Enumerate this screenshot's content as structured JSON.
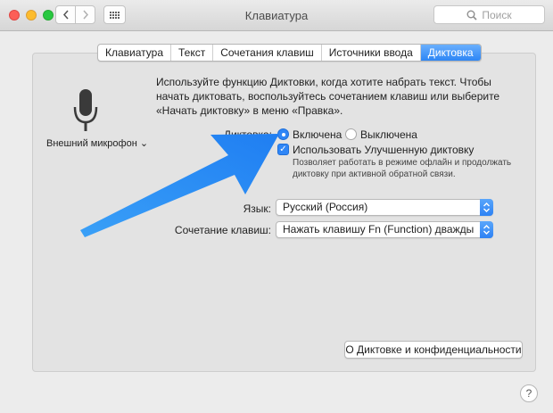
{
  "window": {
    "title": "Клавиатура"
  },
  "search": {
    "placeholder": "Поиск"
  },
  "tabs": [
    {
      "label": "Клавиатура",
      "active": false
    },
    {
      "label": "Текст",
      "active": false
    },
    {
      "label": "Сочетания клавиш",
      "active": false
    },
    {
      "label": "Источники ввода",
      "active": false
    },
    {
      "label": "Диктовка",
      "active": true
    }
  ],
  "mic": {
    "label": "Внешний микрофон ⌄",
    "icon": "microphone-icon"
  },
  "intro": {
    "text": "Используйте функцию Диктовки, когда хотите набрать текст. Чтобы начать диктовать, воспользуйтесь сочетанием клавиш или выберите «Начать диктовку» в меню «Правка»."
  },
  "dictation": {
    "label": "Диктовка:",
    "on_label": "Включена",
    "off_label": "Выключена",
    "selected": "on"
  },
  "enhanced": {
    "label": "Использовать Улучшенную диктовку",
    "checked": true,
    "note": "Позволяет работать в режиме офлайн и продолжать диктовку при активной обратной связи."
  },
  "language": {
    "label": "Язык:",
    "value": "Русский (Россия)"
  },
  "shortcut": {
    "label": "Сочетание клавиш:",
    "value": "Нажать клавишу Fn (Function) дважды"
  },
  "privacy_button": {
    "label": "О Диктовке и конфиденциальности"
  },
  "help_button": {
    "label": "?"
  },
  "colors": {
    "accent": "#2f86f6",
    "annotation_arrow": "#2d8ff5"
  }
}
